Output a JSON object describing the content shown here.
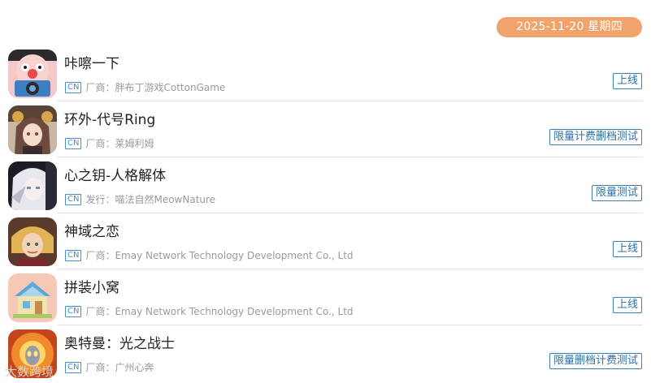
{
  "header": {
    "date": "2025-11-20 星期四"
  },
  "games": [
    {
      "title": "咔嚓一下",
      "region": "CN",
      "company": "厂商：胖布丁游戏CottonGame",
      "status": "上线",
      "icon": "cartoon-pig-camera-icon"
    },
    {
      "title": "环外-代号Ring",
      "region": "CN",
      "company": "厂商：莱姆利姆",
      "status": "限量计费删档测试",
      "icon": "anime-girl-portrait-icon"
    },
    {
      "title": "心之钥-人格解体",
      "region": "CN",
      "company": "发行：喵法自然MeowNature",
      "status": "限量测试",
      "icon": "white-hair-character-icon"
    },
    {
      "title": "神域之恋",
      "region": "CN",
      "company": "厂商：Emay Network Technology Development Co., Ltd",
      "status": "上线",
      "icon": "golden-hair-prince-icon"
    },
    {
      "title": "拼装小窝",
      "region": "CN",
      "company": "厂商：Emay Network Technology Development Co., Ltd",
      "status": "上线",
      "icon": "toy-house-icon"
    },
    {
      "title": "奥特曼：光之战士",
      "region": "CN",
      "company": "厂商：广州心奔",
      "status": "限量删档计费测试",
      "icon": "ultraman-hero-icon"
    }
  ],
  "watermark": "大数跨境",
  "colors": {
    "date_pill": "#f0a46c",
    "tag_blue": "#3b7fb5",
    "meta_gray": "#9a9a9a"
  }
}
